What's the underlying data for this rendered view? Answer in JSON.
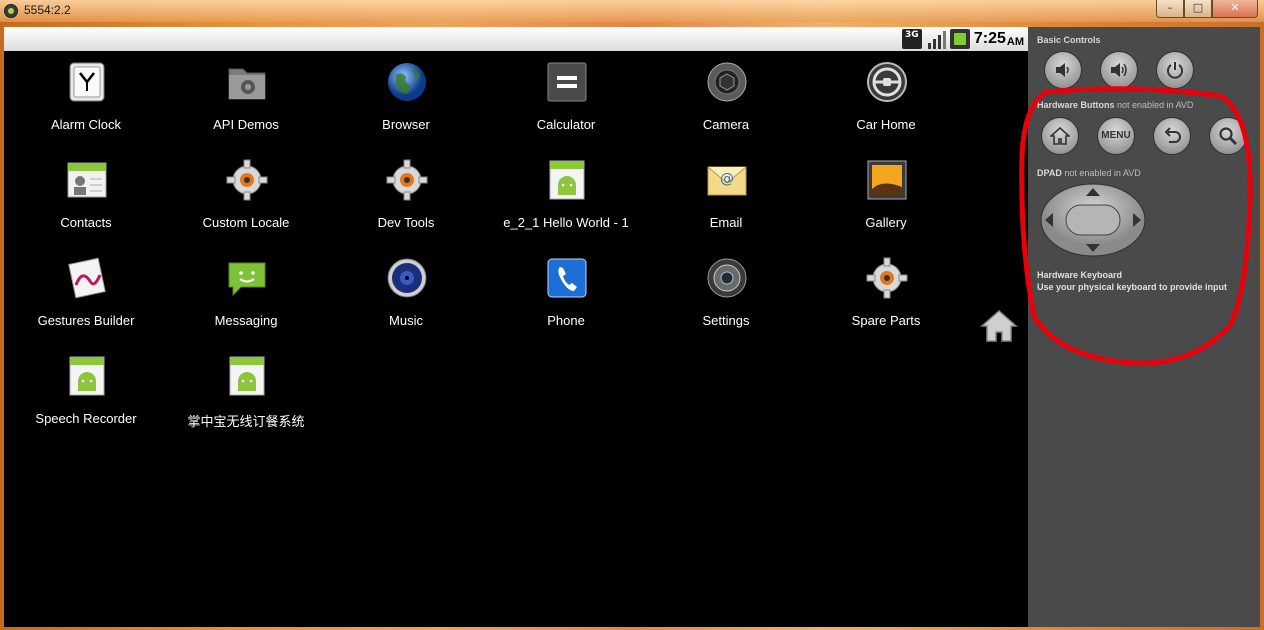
{
  "window": {
    "title": "5554:2.2",
    "controls": [
      "–",
      "□",
      "✕"
    ]
  },
  "statusbar": {
    "network_badge": "3G",
    "time": "7:25",
    "ampm": "AM"
  },
  "apps": [
    {
      "label": "Alarm Clock",
      "icon": "alarm-clock-icon"
    },
    {
      "label": "API Demos",
      "icon": "api-demos-folder-icon"
    },
    {
      "label": "Browser",
      "icon": "browser-globe-icon"
    },
    {
      "label": "Calculator",
      "icon": "calculator-icon"
    },
    {
      "label": "Camera",
      "icon": "camera-icon"
    },
    {
      "label": "Car Home",
      "icon": "car-home-icon"
    },
    {
      "label": "Contacts",
      "icon": "contacts-icon"
    },
    {
      "label": "Custom Locale",
      "icon": "gear-icon"
    },
    {
      "label": "Dev Tools",
      "icon": "gear-icon"
    },
    {
      "label": "e_2_1 Hello World - 1",
      "icon": "android-app-icon"
    },
    {
      "label": "Email",
      "icon": "email-icon"
    },
    {
      "label": "Gallery",
      "icon": "gallery-icon"
    },
    {
      "label": "Gestures Builder",
      "icon": "gestures-icon"
    },
    {
      "label": "Messaging",
      "icon": "messaging-icon"
    },
    {
      "label": "Music",
      "icon": "music-icon"
    },
    {
      "label": "Phone",
      "icon": "phone-icon"
    },
    {
      "label": "Settings",
      "icon": "settings-icon"
    },
    {
      "label": "Spare Parts",
      "icon": "gear-icon"
    },
    {
      "label": "Speech Recorder",
      "icon": "android-app-icon"
    },
    {
      "label": "掌中宝无线订餐系统",
      "icon": "android-app-icon"
    }
  ],
  "panel": {
    "basic_controls": "Basic Controls",
    "hardware_buttons": "Hardware Buttons",
    "hardware_buttons_note": "not enabled in AVD",
    "menu_label": "MENU",
    "dpad": "DPAD",
    "dpad_note": "not enabled in AVD",
    "keyboard_title": "Hardware Keyboard",
    "keyboard_desc": "Use your physical keyboard to provide input"
  },
  "colors": {
    "highlight": "#e8000a",
    "panel_bg": "#4a4a4a",
    "screen_bg": "#000000"
  }
}
